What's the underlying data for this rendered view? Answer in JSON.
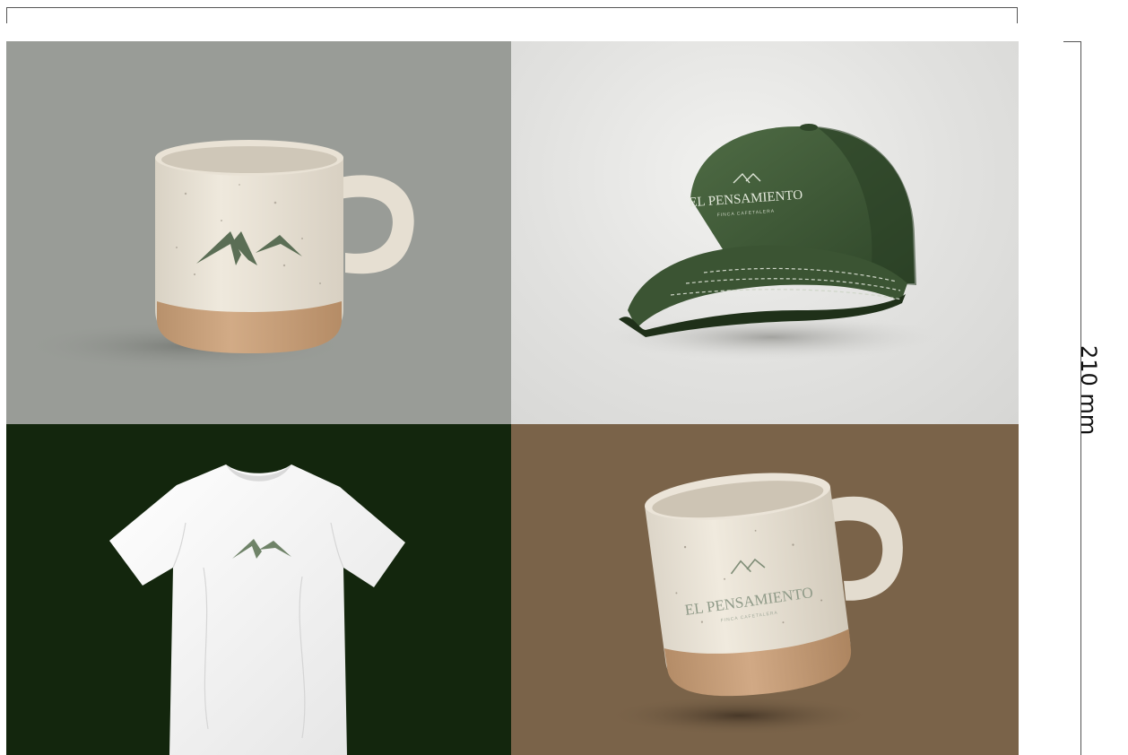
{
  "dimension_label": "210 mm",
  "brand": {
    "name": "EL PENSAMIENTO",
    "tagline": "FINCA CAFETALERA"
  },
  "colors": {
    "panel_top_left": "#999c97",
    "panel_bottom_left": "#13260d",
    "panel_bottom_right": "#7a6349",
    "brand_green": "#44603c",
    "ceramic": "#ece6da",
    "clay": "#c9a27c"
  },
  "mockups": [
    {
      "item": "speckled ceramic mug with mountain logo"
    },
    {
      "item": "green baseball cap with EL PENSAMIENTO logo"
    },
    {
      "item": "white t-shirt with mountain logo"
    },
    {
      "item": "speckled ceramic mug with EL PENSAMIENTO logo"
    }
  ]
}
